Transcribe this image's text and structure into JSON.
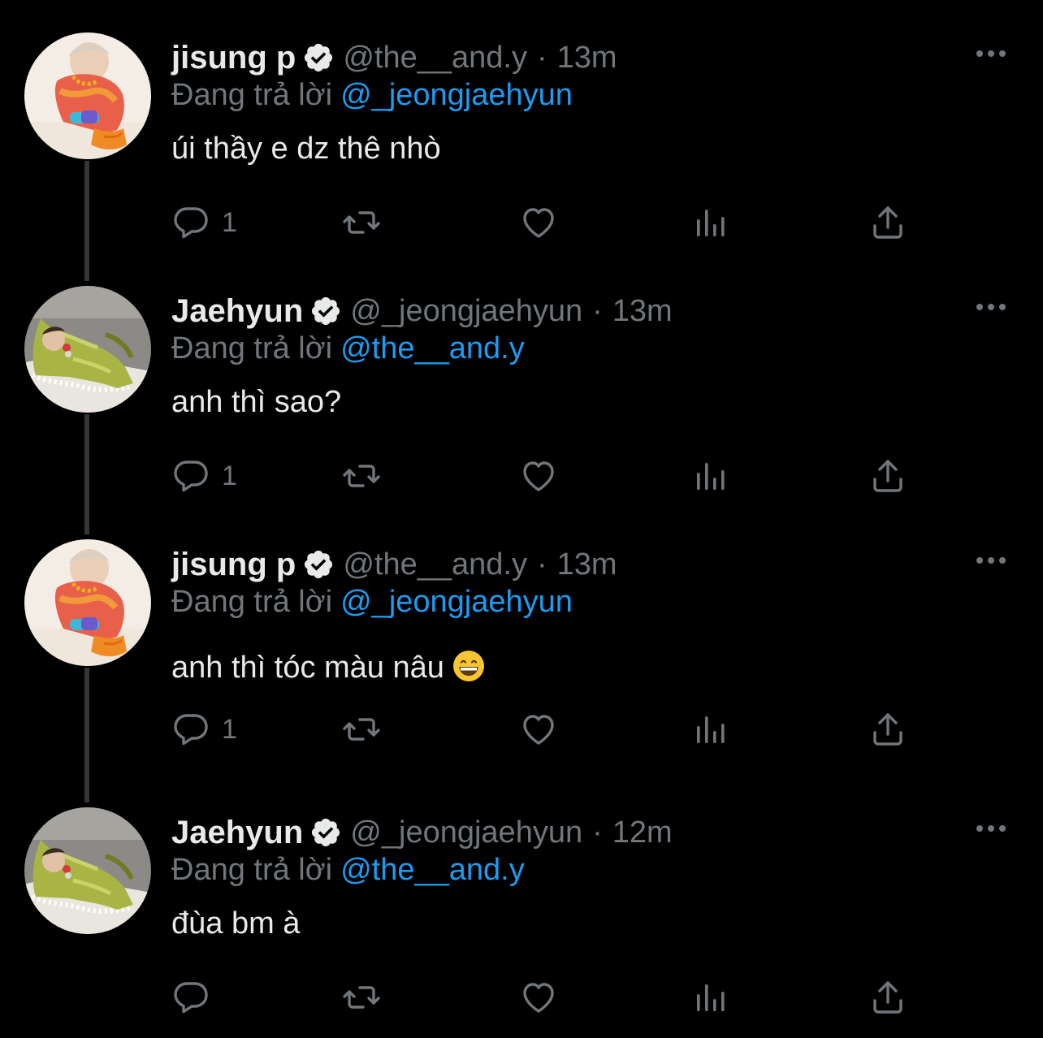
{
  "tweets": [
    {
      "name": "jisung p",
      "handle": "@the__and.y",
      "time": "13m",
      "replying_prefix": "Đang trả lời",
      "replying_to": "@_jeongjaehyun",
      "text": "úi thầy e dz thê nhò",
      "reply_count": "1",
      "avatar": "avatar-colorful-sweater"
    },
    {
      "name": "Jaehyun",
      "handle": "@_jeongjaehyun",
      "time": "13m",
      "replying_prefix": "Đang trả lời",
      "replying_to": "@the__and.y",
      "text": "anh thì sao?",
      "reply_count": "1",
      "avatar": "avatar-green-jacket"
    },
    {
      "name": "jisung p",
      "handle": "@the__and.y",
      "time": "13m",
      "replying_prefix": "Đang trả lời",
      "replying_to": "@_jeongjaehyun",
      "text": "anh thì tóc màu nâu",
      "emoji": "grinning-face-emoji",
      "reply_count": "1",
      "avatar": "avatar-colorful-sweater"
    },
    {
      "name": "Jaehyun",
      "handle": "@_jeongjaehyun",
      "time": "12m",
      "replying_prefix": "Đang trả lời",
      "replying_to": "@the__and.y",
      "text": "đùa bm à",
      "reply_count": "",
      "avatar": "avatar-green-jacket"
    }
  ],
  "icons": {
    "reply": "reply-icon",
    "retweet": "retweet-icon",
    "like": "heart-icon",
    "views": "analytics-icon",
    "share": "share-icon",
    "more": "more-icon",
    "verified": "verified-badge-icon"
  },
  "colors": {
    "background": "#000000",
    "text": "#e7e9ea",
    "secondary": "#71767b",
    "link": "#1d9bf0",
    "thread_line": "#333639"
  }
}
